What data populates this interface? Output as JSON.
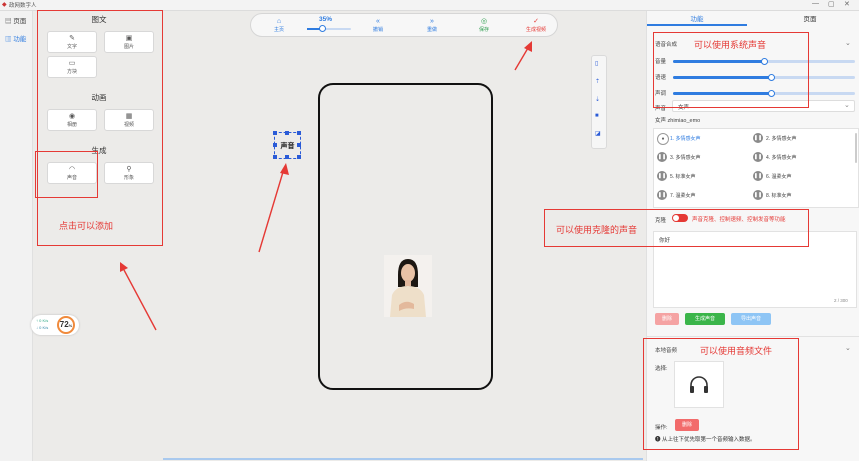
{
  "app": {
    "title": "政网数字人",
    "window_buttons": [
      "—",
      "▢",
      "✕"
    ]
  },
  "rail": {
    "items": [
      {
        "label": "页面",
        "icon": "page-icon"
      },
      {
        "label": "功能",
        "icon": "function-icon"
      }
    ]
  },
  "tools": {
    "sections": [
      {
        "title": "图文",
        "items": [
          {
            "label": "文字",
            "icon": "edit-icon"
          },
          {
            "label": "图片",
            "icon": "image-icon"
          },
          {
            "label": "方块",
            "icon": "shape-icon"
          }
        ]
      },
      {
        "title": "动画",
        "items": [
          {
            "label": "相册",
            "icon": "camera-icon"
          },
          {
            "label": "视频",
            "icon": "film-icon"
          }
        ]
      },
      {
        "title": "生成",
        "items": [
          {
            "label": "声音",
            "icon": "headphones-icon"
          },
          {
            "label": "形象",
            "icon": "person-icon"
          }
        ]
      }
    ]
  },
  "toolbar": {
    "zoom": "35%",
    "zoom_level": 0.35,
    "buttons": [
      {
        "label": "主页",
        "icon": "home-icon",
        "color": "#2f7ce0"
      },
      {
        "label": "撤销",
        "icon": "undo-icon",
        "color": "#2f7ce0"
      },
      {
        "label": "重做",
        "icon": "redo-icon",
        "color": "#2f7ce0"
      },
      {
        "label": "保存",
        "icon": "save-icon",
        "color": "#2e9e4f"
      },
      {
        "label": "生成视频",
        "icon": "check-icon",
        "color": "#e53935"
      }
    ]
  },
  "canvas": {
    "sound_element_label": "声音"
  },
  "stats": {
    "up": "↑ 0  K/s",
    "down": "↓ 0  K/s",
    "percent": "72",
    "unit": "%"
  },
  "panel": {
    "tabs": [
      "功能",
      "页面"
    ],
    "tts": {
      "section_title": "语音合成",
      "sliders": [
        {
          "label": "音量",
          "value": 0.5
        },
        {
          "label": "语速",
          "value": 0.54
        },
        {
          "label": "声调",
          "value": 0.54
        }
      ],
      "voice_label": "声音",
      "voice_value": "女声",
      "voice_group": "女声 zhimiao_emo",
      "voices": [
        "1. 多情感女声",
        "2. 多情感女声",
        "3. 多情感女声",
        "4. 多情感女声",
        "5. 标准女声",
        "6. 温柔女声",
        "7. 温柔女声",
        "8. 标准女声"
      ]
    },
    "clone": {
      "label": "克隆",
      "desc": "声音克隆、控制速频、控制发音等功能",
      "text": "你好",
      "counter": "2 / 300",
      "buttons": [
        {
          "label": "删除",
          "color": "#f5a3a3"
        },
        {
          "label": "生成声音",
          "color": "#3bb54a"
        },
        {
          "label": "导出声音",
          "color": "#8ec5f5"
        }
      ]
    },
    "local": {
      "title": "本地音频",
      "select_label": "选择:",
      "op_label": "操作:",
      "delete_label": "删除",
      "hint": "从上往下优先取第一个音频输入数据。"
    }
  },
  "annotations": {
    "add": "点击可以添加",
    "system_voice": "可以使用系统声音",
    "clone_voice": "可以使用克隆的声音",
    "audio_file": "可以使用音频文件"
  },
  "colors": {
    "accent": "#2f7ce0",
    "annotation": "#e53935"
  }
}
